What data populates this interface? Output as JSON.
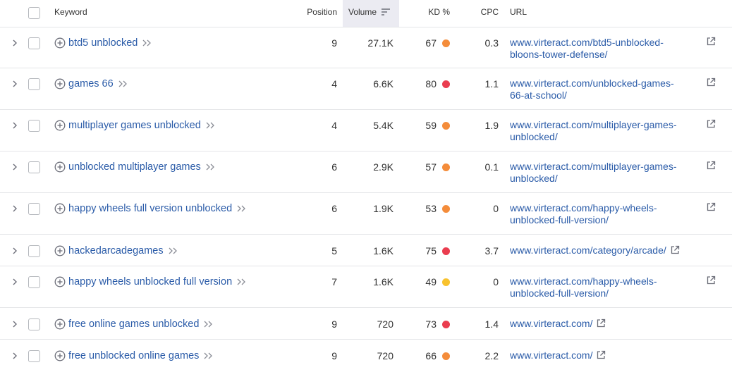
{
  "header": {
    "keyword": "Keyword",
    "position": "Position",
    "volume": "Volume",
    "kd": "KD %",
    "cpc": "CPC",
    "url": "URL"
  },
  "colors": {
    "link": "#2a5ba8",
    "kd_orange": "#f48c3a",
    "kd_red": "#ea3d4f",
    "kd_yellow": "#f8c22e",
    "sorted_header_bg": "#ebebf2"
  },
  "rows": [
    {
      "keyword": "btd5 unblocked",
      "position": "9",
      "volume": "27.1K",
      "kd": "67",
      "kd_level": "orange",
      "cpc": "0.3",
      "url_lines": [
        "www.virteract.com/btd5-unblocked-",
        "bloons-tower-defense/"
      ]
    },
    {
      "keyword": "games 66",
      "position": "4",
      "volume": "6.6K",
      "kd": "80",
      "kd_level": "red",
      "cpc": "1.1",
      "url_lines": [
        "www.virteract.com/unblocked-games-",
        "66-at-school/"
      ]
    },
    {
      "keyword": "multiplayer games unblocked",
      "position": "4",
      "volume": "5.4K",
      "kd": "59",
      "kd_level": "orange",
      "cpc": "1.9",
      "url_lines": [
        "www.virteract.com/multiplayer-games-",
        "unblocked/"
      ]
    },
    {
      "keyword": "unblocked multiplayer games",
      "position": "6",
      "volume": "2.9K",
      "kd": "57",
      "kd_level": "orange",
      "cpc": "0.1",
      "url_lines": [
        "www.virteract.com/multiplayer-games-",
        "unblocked/"
      ]
    },
    {
      "keyword": "happy wheels full version unblocked",
      "position": "6",
      "volume": "1.9K",
      "kd": "53",
      "kd_level": "orange",
      "cpc": "0",
      "url_lines": [
        "www.virteract.com/happy-wheels-",
        "unblocked-full-version/"
      ]
    },
    {
      "keyword": "hackedarcadegames",
      "position": "5",
      "volume": "1.6K",
      "kd": "75",
      "kd_level": "red",
      "cpc": "3.7",
      "url_lines": [
        "www.virteract.com/category/arcade/"
      ]
    },
    {
      "keyword": "happy wheels unblocked full version",
      "position": "7",
      "volume": "1.6K",
      "kd": "49",
      "kd_level": "yellow",
      "cpc": "0",
      "url_lines": [
        "www.virteract.com/happy-wheels-",
        "unblocked-full-version/"
      ]
    },
    {
      "keyword": "free online games unblocked",
      "position": "9",
      "volume": "720",
      "kd": "73",
      "kd_level": "red",
      "cpc": "1.4",
      "url_lines": [
        "www.virteract.com/"
      ]
    },
    {
      "keyword": "free unblocked online games",
      "position": "9",
      "volume": "720",
      "kd": "66",
      "kd_level": "orange",
      "cpc": "2.2",
      "url_lines": [
        "www.virteract.com/"
      ]
    }
  ]
}
